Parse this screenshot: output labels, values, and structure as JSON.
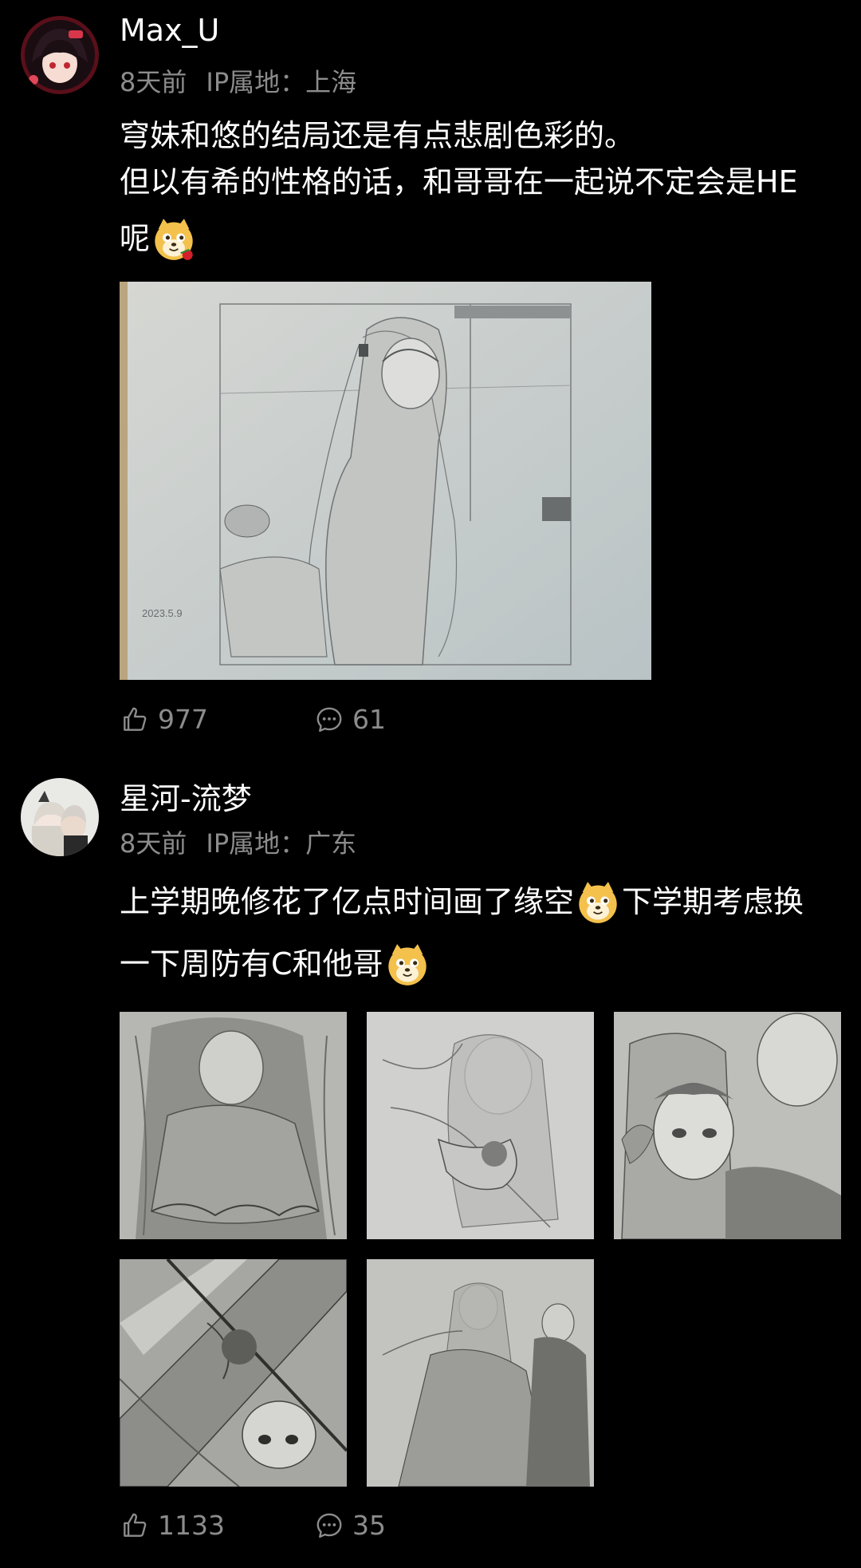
{
  "comments": [
    {
      "username": "Max_U",
      "time": "8天前",
      "ip": "IP属地：上海",
      "lines": [
        "穹妹和悠的结局还是有点悲剧色彩的。",
        "但以有希的性格的话，和哥哥在一起说不定会是HE",
        "呢"
      ],
      "likes": "977",
      "replies": "61",
      "images": [
        {
          "icon": "pencil-sketch-image",
          "date_text": "2023.5.9"
        }
      ]
    },
    {
      "username": "星河-流梦",
      "time": "8天前",
      "ip": "IP属地：广东",
      "lines": [
        "上学期晚修花了亿点时间画了缘空",
        "下学期考虑换",
        "一下周防有C和他哥"
      ],
      "likes": "1133",
      "replies": "35",
      "images": [
        {
          "icon": "pencil-sketch-image"
        },
        {
          "icon": "pencil-sketch-image"
        },
        {
          "icon": "pencil-sketch-image"
        },
        {
          "icon": "pencil-sketch-image"
        },
        {
          "icon": "pencil-sketch-image"
        }
      ]
    }
  ],
  "colors": {
    "background": "#000000",
    "meta": "#8c8c8c",
    "text": "#ffffff"
  },
  "icons": {
    "like": "thumbs-up-icon",
    "reply": "comment-bubble-icon",
    "emoji": "doge-emoji-icon"
  }
}
